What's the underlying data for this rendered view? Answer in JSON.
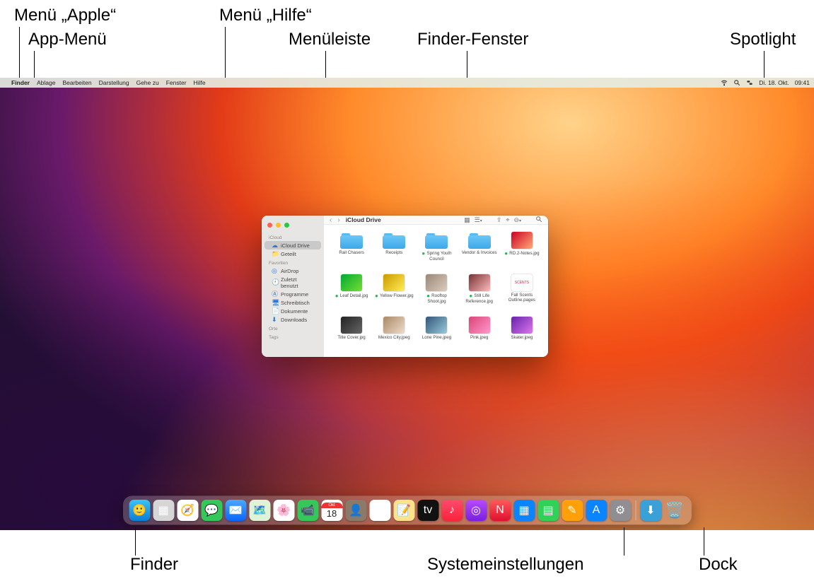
{
  "callouts": {
    "apple_menu": "Menü „Apple“",
    "app_menu": "App-Menü",
    "help_menu": "Menü „Hilfe“",
    "menubar": "Menüleiste",
    "finder_window": "Finder-Fenster",
    "spotlight": "Spotlight",
    "finder_dock": "Finder",
    "system_settings": "Systemeinstellungen",
    "dock": "Dock"
  },
  "menubar": {
    "apple_glyph": "",
    "items": [
      "Finder",
      "Ablage",
      "Bearbeiten",
      "Darstellung",
      "Gehe zu",
      "Fenster",
      "Hilfe"
    ],
    "status_date": "Di. 18. Okt.",
    "status_time": "09:41"
  },
  "finder": {
    "title": "iCloud Drive",
    "sidebar": {
      "sections": [
        {
          "title": "iCloud",
          "items": [
            {
              "icon": "cloud-icon",
              "label": "iCloud Drive",
              "selected": true
            },
            {
              "icon": "shared-icon",
              "label": "Geteilt",
              "selected": false
            }
          ]
        },
        {
          "title": "Favoriten",
          "items": [
            {
              "icon": "airdrop-icon",
              "label": "AirDrop"
            },
            {
              "icon": "clock-icon",
              "label": "Zuletzt benutzt"
            },
            {
              "icon": "apps-icon",
              "label": "Programme"
            },
            {
              "icon": "desktop-icon",
              "label": "Schreibtisch"
            },
            {
              "icon": "doc-icon",
              "label": "Dokumente"
            },
            {
              "icon": "downloads-icon",
              "label": "Downloads"
            }
          ]
        },
        {
          "title": "Orte",
          "items": []
        },
        {
          "title": "Tags",
          "items": []
        }
      ]
    },
    "files": [
      {
        "kind": "folder",
        "name": "Rail Chasers",
        "dot": false
      },
      {
        "kind": "folder",
        "name": "Receipts",
        "dot": false
      },
      {
        "kind": "folder",
        "name": "Spring Youth Council",
        "dot": true
      },
      {
        "kind": "folder",
        "name": "Vendor & Invoices",
        "dot": false
      },
      {
        "kind": "image",
        "name": "RD.2-Notes.jpg",
        "dot": true,
        "bg": "linear-gradient(135deg,#c02,#fa7)"
      },
      {
        "kind": "image",
        "name": "Leaf Detail.jpg",
        "dot": true,
        "bg": "linear-gradient(135deg,#0a3,#7d3)"
      },
      {
        "kind": "image",
        "name": "Yellow Flower.jpg",
        "dot": true,
        "bg": "linear-gradient(135deg,#c90,#fe5)"
      },
      {
        "kind": "image",
        "name": "Rooftop Shoot.jpg",
        "dot": true,
        "bg": "linear-gradient(135deg,#987,#dcb)"
      },
      {
        "kind": "image",
        "name": "Still Life Reference.jpg",
        "dot": true,
        "bg": "linear-gradient(135deg,#733,#fbb)"
      },
      {
        "kind": "image",
        "name": "Fall Scents Outline.pages",
        "dot": false,
        "bg": "linear-gradient(#fff,#fff)",
        "text": "#d23"
      },
      {
        "kind": "image",
        "name": "Title Cover.jpg",
        "dot": false,
        "bg": "linear-gradient(135deg,#222,#666)"
      },
      {
        "kind": "image",
        "name": "Mexico City.jpeg",
        "dot": false,
        "bg": "linear-gradient(135deg,#a86,#edc)"
      },
      {
        "kind": "image",
        "name": "Lone Pine.jpeg",
        "dot": false,
        "bg": "linear-gradient(135deg,#357,#9cd)"
      },
      {
        "kind": "image",
        "name": "Pink.jpeg",
        "dot": false,
        "bg": "linear-gradient(135deg,#d47,#f9c)"
      },
      {
        "kind": "image",
        "name": "Skater.jpeg",
        "dot": false,
        "bg": "linear-gradient(135deg,#62a,#d7e)"
      }
    ]
  },
  "dock": {
    "items": [
      {
        "name": "finder",
        "bg": "linear-gradient(#3ac3f5,#0a7ed8)",
        "glyph": "🙂"
      },
      {
        "name": "launchpad",
        "bg": "#d6d6d6",
        "glyph": "▦"
      },
      {
        "name": "safari",
        "bg": "#fff",
        "glyph": "🧭"
      },
      {
        "name": "messages",
        "bg": "#34c759",
        "glyph": "💬"
      },
      {
        "name": "mail",
        "bg": "linear-gradient(#4aa8ff,#0a66ff)",
        "glyph": "✉️"
      },
      {
        "name": "maps",
        "bg": "#dff3d7",
        "glyph": "🗺️"
      },
      {
        "name": "photos",
        "bg": "#fff",
        "glyph": "🌸"
      },
      {
        "name": "facetime",
        "bg": "#34c759",
        "glyph": "📹"
      },
      {
        "name": "calendar",
        "bg": "#fff",
        "glyph": "18",
        "text": "#e33",
        "label": "Okt"
      },
      {
        "name": "contacts",
        "bg": "#8a7a6a",
        "glyph": "👤"
      },
      {
        "name": "reminders",
        "bg": "#fff",
        "glyph": "☑︎"
      },
      {
        "name": "notes",
        "bg": "#ffe28a",
        "glyph": "📝"
      },
      {
        "name": "tv",
        "bg": "#111",
        "glyph": "tv"
      },
      {
        "name": "music",
        "bg": "linear-gradient(#ff4b6e,#fa233b)",
        "glyph": "♪"
      },
      {
        "name": "podcasts",
        "bg": "linear-gradient(#b84bff,#7a1fe0)",
        "glyph": "◎"
      },
      {
        "name": "news",
        "bg": "linear-gradient(#ff5a5a,#e01030)",
        "glyph": "N"
      },
      {
        "name": "keynote",
        "bg": "#0a84ff",
        "glyph": "▦"
      },
      {
        "name": "numbers",
        "bg": "#30d158",
        "glyph": "▤"
      },
      {
        "name": "pages",
        "bg": "#ff9f0a",
        "glyph": "✎"
      },
      {
        "name": "appstore",
        "bg": "#0a84ff",
        "glyph": "A"
      },
      {
        "name": "system-settings",
        "bg": "#8e8e93",
        "glyph": "⚙︎"
      }
    ],
    "right_items": [
      {
        "name": "downloads",
        "bg": "#3aa0d8",
        "glyph": "⬇︎"
      },
      {
        "name": "trash",
        "bg": "transparent",
        "glyph": "🗑️"
      }
    ]
  }
}
